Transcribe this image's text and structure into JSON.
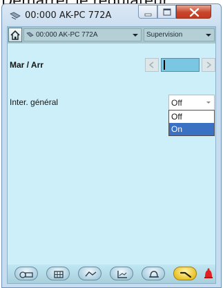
{
  "page_caption": "Démarrer le régulateur",
  "window": {
    "title": "00:000 AK-PC 772A",
    "buttons": {
      "minimize": "minimize",
      "maximize": "maximize",
      "close": "close"
    }
  },
  "toolbar": {
    "device_select": "00:000 AK-PC 772A",
    "mode_select": "Supervision"
  },
  "main": {
    "heading": "Mar / Arr",
    "parameter": {
      "label": "Inter. général",
      "value": "Off",
      "options": [
        "Off",
        "On"
      ],
      "highlighted_option": "On"
    }
  },
  "bottom_tabs": [
    {
      "icon": "plant-overview-icon"
    },
    {
      "icon": "table-icon"
    },
    {
      "icon": "compressor-icon"
    },
    {
      "icon": "graph-icon"
    },
    {
      "icon": "alarm-bell-icon"
    },
    {
      "icon": "wrench-icon",
      "active": true
    }
  ],
  "colors": {
    "client_background": "#cdeffa",
    "toolbar": "#a7c6cd",
    "selected_option": "#3b71c3",
    "active_tab": "#e9c021",
    "alarm": "#e02020"
  }
}
